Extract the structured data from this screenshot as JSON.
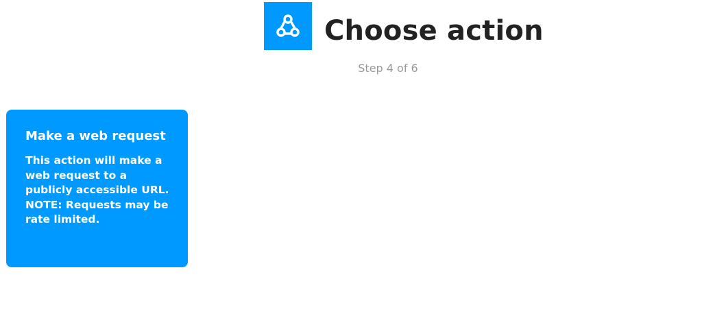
{
  "header": {
    "service_icon": "webhooks-icon",
    "title": "Choose action",
    "step": "Step 4 of 6"
  },
  "actions": [
    {
      "title": "Make a web request",
      "description": "This action will make a web request to a publicly accessible URL. NOTE: Requests may be rate limited."
    }
  ],
  "colors": {
    "brand": "#0099ff",
    "title": "#222222",
    "muted": "#999999",
    "card_text": "#ffffff"
  }
}
